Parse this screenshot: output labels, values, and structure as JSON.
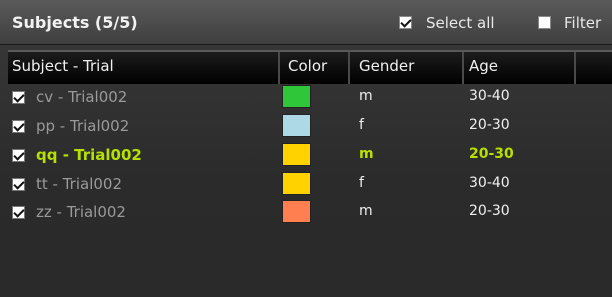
{
  "header": {
    "title": "Subjects (5/5)",
    "select_all_label": "Select all",
    "filter_label": "Filter"
  },
  "columns": [
    "Subject - Trial",
    "Color",
    "Gender",
    "Age"
  ],
  "rows": [
    {
      "subject": "cv - Trial002",
      "color": "#2fc63a",
      "gender": "m",
      "age": "30-40",
      "checked": true,
      "highlight": false
    },
    {
      "subject": "pp - Trial002",
      "color": "#add8e6",
      "gender": "f",
      "age": "20-30",
      "checked": true,
      "highlight": false
    },
    {
      "subject": "qq - Trial002",
      "color": "#ffd200",
      "gender": "m",
      "age": "20-30",
      "checked": true,
      "highlight": true
    },
    {
      "subject": "tt - Trial002",
      "color": "#ffd200",
      "gender": "f",
      "age": "30-40",
      "checked": true,
      "highlight": false
    },
    {
      "subject": "zz - Trial002",
      "color": "#ff7f50",
      "gender": "m",
      "age": "20-30",
      "checked": true,
      "highlight": false
    }
  ],
  "colors": {
    "highlight_text": "#b7e000"
  }
}
